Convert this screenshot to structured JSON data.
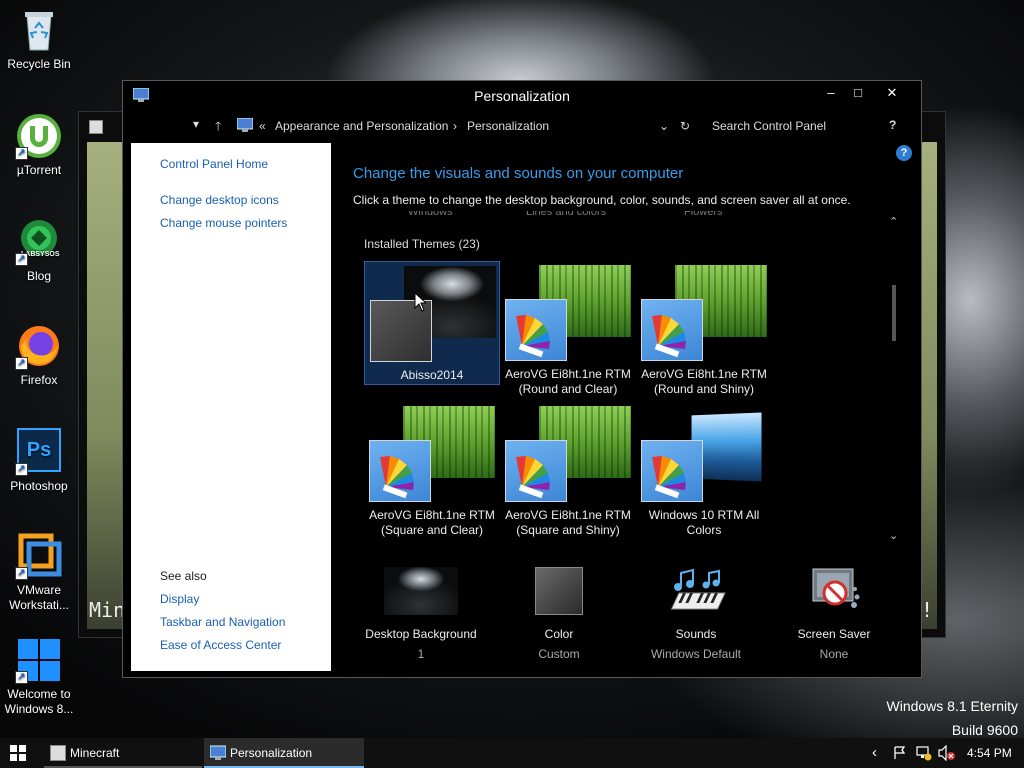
{
  "desktop": {
    "icons": [
      {
        "label": "Recycle Bin"
      },
      {
        "label": "µTorrent"
      },
      {
        "label": "Blog"
      },
      {
        "label": "Firefox"
      },
      {
        "label": "Photoshop"
      },
      {
        "label": "VMware Workstati..."
      },
      {
        "label": "Welcome to Windows 8..."
      }
    ],
    "blog_logo_text": "LABSYSOS",
    "ps_text": "Ps",
    "bg_window_left_text": "Mine",
    "bg_window_right_text": "e!"
  },
  "window": {
    "title": "Personalization",
    "controls": {
      "minimize": "–",
      "maximize": "□",
      "close": "✕"
    },
    "address": {
      "back_icon": "▾",
      "up_icon": "🡑",
      "separator": "«",
      "crumbs": [
        "Appearance and Personalization",
        "Personalization"
      ],
      "crumb_sep": "›",
      "dropdown": "⌄",
      "refresh": "↻",
      "search_placeholder": "Search Control Panel",
      "help": "?"
    },
    "help_circle": "?",
    "left_pane": {
      "links": [
        "Control Panel Home",
        "Change desktop icons",
        "Change mouse pointers"
      ],
      "see_also_label": "See also",
      "see_also_links": [
        "Display",
        "Taskbar and Navigation",
        "Ease of Access Center"
      ]
    },
    "main": {
      "heading": "Change the visuals and sounds on your computer",
      "description": "Click a theme to change the desktop background, color, sounds, and screen saver all at once.",
      "cutoff_labels": [
        "Windows",
        "Lines and colors",
        "Flowers"
      ],
      "section_label": "Installed Themes (23)",
      "themes": [
        {
          "name": "Abisso2014",
          "selected": true
        },
        {
          "name": "AeroVG Ei8ht.1ne RTM (Round and Clear)"
        },
        {
          "name": "AeroVG Ei8ht.1ne RTM (Round and Shiny)"
        },
        {
          "name": "AeroVG Ei8ht.1ne RTM (Square and Clear)"
        },
        {
          "name": "AeroVG Ei8ht.1ne RTM (Square and Shiny)"
        },
        {
          "name": "Windows 10 RTM All Colors"
        }
      ],
      "scroll_up": "⌃",
      "scroll_down": "⌄",
      "bottom": [
        {
          "label": "Desktop Background",
          "value": "1"
        },
        {
          "label": "Color",
          "value": "Custom"
        },
        {
          "label": "Sounds",
          "value": "Windows Default"
        },
        {
          "label": "Screen Saver",
          "value": "None"
        }
      ]
    }
  },
  "watermark": {
    "line1": "Windows 8.1 Eternity",
    "line2": "Build 9600"
  },
  "taskbar": {
    "items": [
      {
        "label": "Minecraft"
      },
      {
        "label": "Personalization",
        "active": true
      }
    ],
    "tray": {
      "chevron": "‹",
      "time": "4:54 PM"
    }
  },
  "colors": {
    "accent": "#3a9ce8",
    "link": "#1a5fb4",
    "selected_bg": "#0f2a4d"
  }
}
